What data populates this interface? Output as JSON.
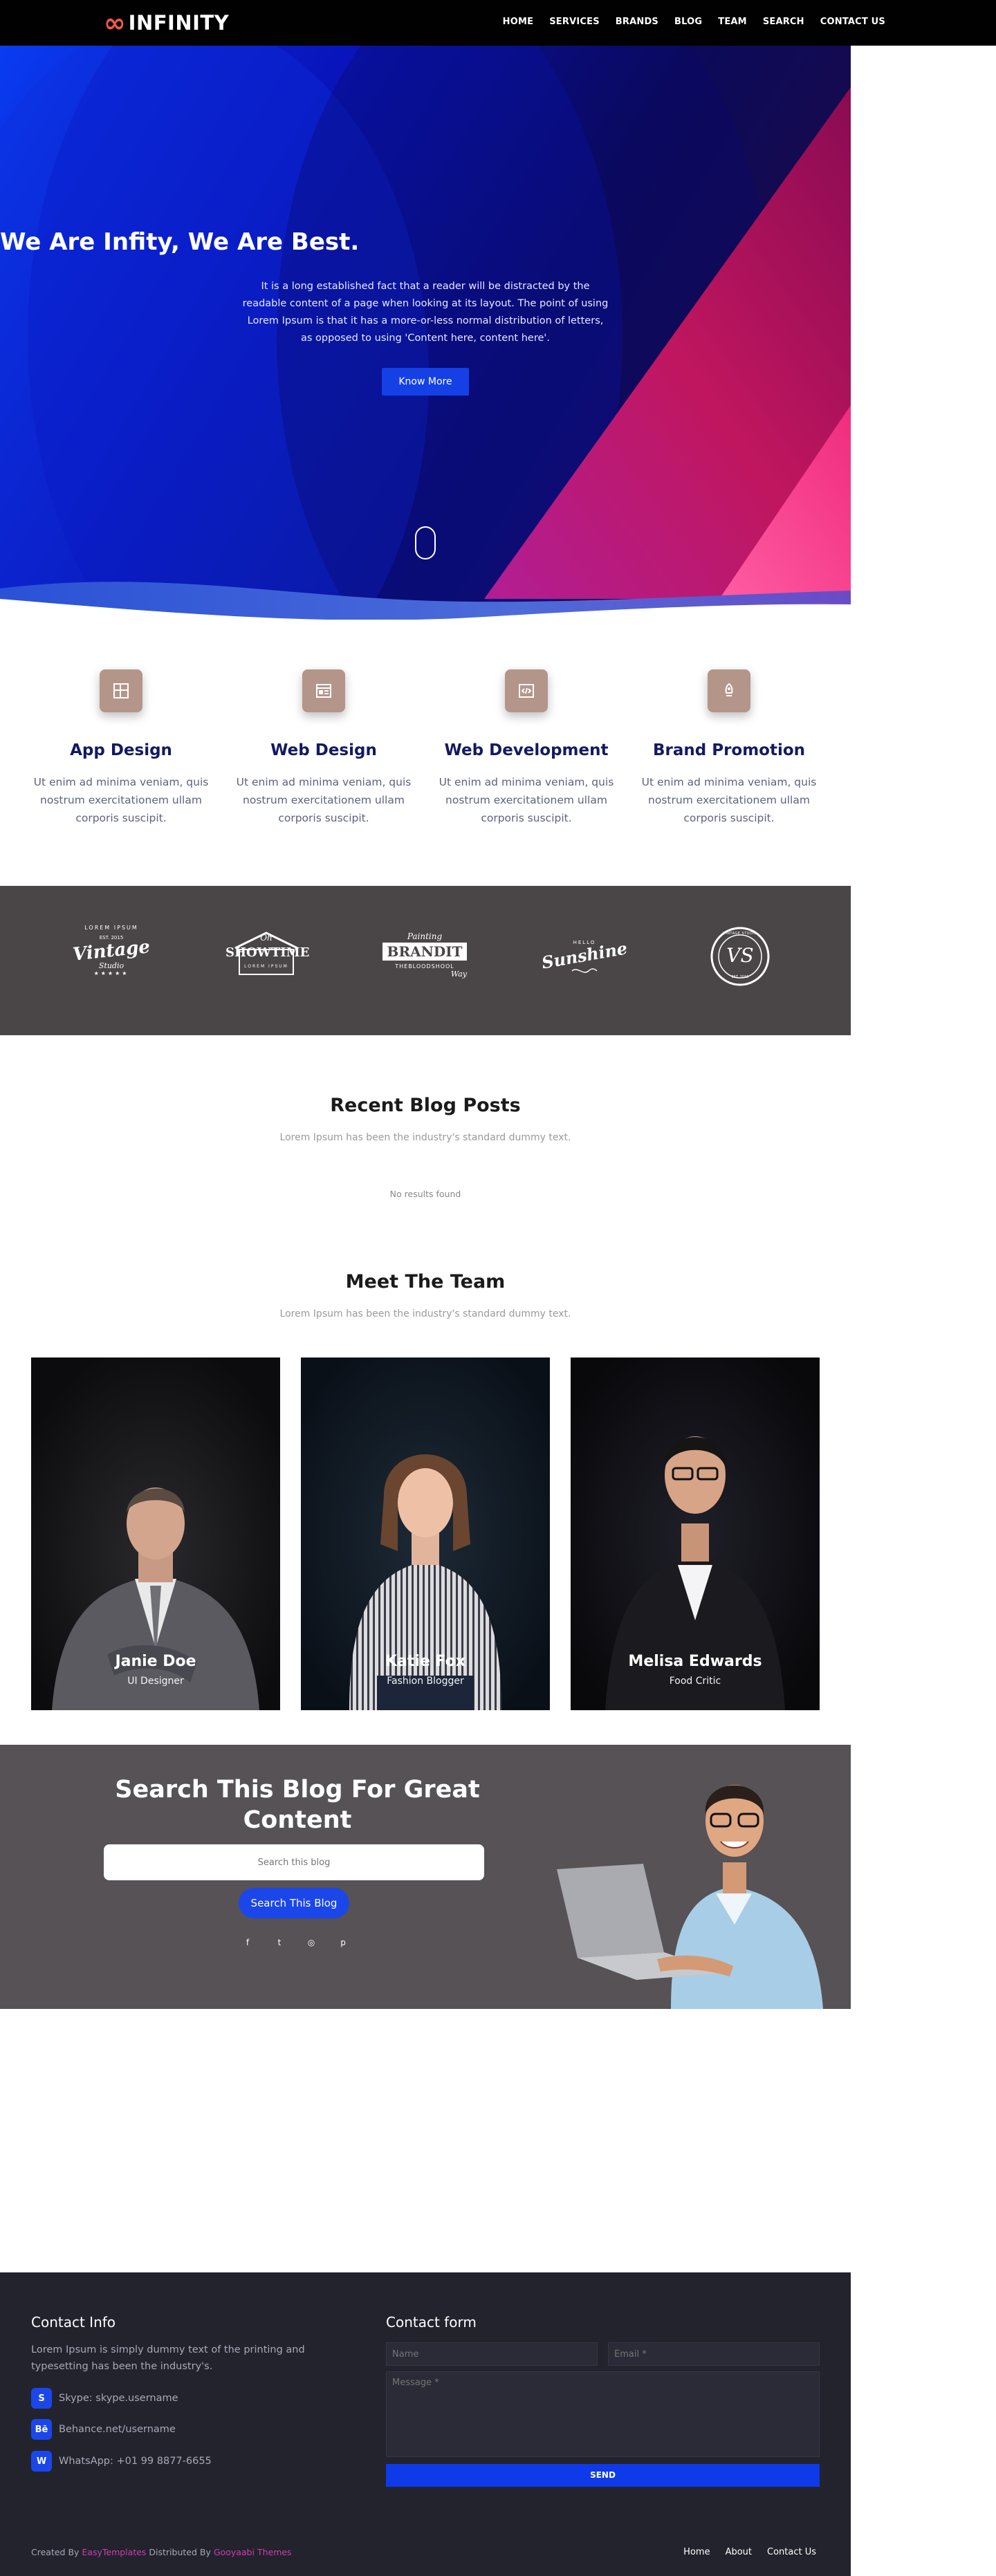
{
  "nav": {
    "logo_symbol": "∞",
    "logo_text": "INFINITY",
    "items": [
      "HOME",
      "SERVICES",
      "BRANDS",
      "BLOG",
      "TEAM",
      "SEARCH",
      "CONTACT US"
    ]
  },
  "hero": {
    "title": "We Are Infity, We Are Best.",
    "text": "It is a long established fact that a reader will be distracted by the readable content of a page when looking at its layout. The point of using Lorem Ipsum is that it has a more-or-less normal distribution of letters, as opposed to using 'Content here, content here'.",
    "button": "Know More"
  },
  "services": [
    {
      "icon": "layout-icon",
      "title": "App Design",
      "text": "Ut enim ad minima veniam, quis nostrum exercitationem ullam corporis suscipit."
    },
    {
      "icon": "browser-icon",
      "title": "Web Design",
      "text": "Ut enim ad minima veniam, quis nostrum exercitationem ullam corporis suscipit."
    },
    {
      "icon": "code-icon",
      "title": "Web Development",
      "text": "Ut enim ad minima veniam, quis nostrum exercitationem ullam corporis suscipit."
    },
    {
      "icon": "rocket-icon",
      "title": "Brand Promotion",
      "text": "Ut enim ad minima veniam, quis nostrum exercitationem ullam corporis suscipit."
    }
  ],
  "brands": {
    "vintage": {
      "top": "LOREM IPSUM",
      "sub": "EST. 2015",
      "main": "Vintage",
      "small": "Studio"
    },
    "showtime": {
      "top": "Oh",
      "main": "SHOWTIME",
      "small": "LOREM IPSUM"
    },
    "brandit": {
      "top": "Painting",
      "main": "BRANDIT",
      "sub": "THEBLOODSHOOL",
      "small": "Way"
    },
    "sunshine": {
      "top": "HELLO",
      "main": "Sunshine"
    },
    "vs": {
      "top": "VINTAGE STUDIO",
      "main": "VS",
      "small": "EST. 2015"
    }
  },
  "blog": {
    "title": "Recent Blog Posts",
    "subtitle": "Lorem Ipsum has been the industry's standard dummy text.",
    "empty": "No results found"
  },
  "team": {
    "title": "Meet The Team",
    "subtitle": "Lorem Ipsum has been the industry's standard dummy text.",
    "members": [
      {
        "name": "Janie Doe",
        "role": "UI Designer"
      },
      {
        "name": "Katie Fox",
        "role": "Fashion Blogger"
      },
      {
        "name": "Melisa Edwards",
        "role": "Food Critic"
      }
    ]
  },
  "search": {
    "title": "Search This Blog For Great Content",
    "placeholder": "Search this blog",
    "button": "Search This Blog",
    "socials": [
      "f",
      "t",
      "◎",
      "p"
    ]
  },
  "footer": {
    "info_title": "Contact Info",
    "info_text": "Lorem Ipsum is simply dummy text of the printing and typesetting has been the industry's.",
    "contacts": [
      {
        "icon": "S",
        "text": "Skype: skype.username"
      },
      {
        "icon": "Bē",
        "text": "Behance.net/username"
      },
      {
        "icon": "W",
        "text": "WhatsApp: +01 99 8877-6655"
      }
    ],
    "form_title": "Contact form",
    "name_placeholder": "Name",
    "email_placeholder": "Email *",
    "message_placeholder": "Message *",
    "send": "SEND",
    "credit_prefix": "Created By",
    "credit_author": "EasyTemplates",
    "credit_mid": "Distributed By",
    "credit_dist": "Gooyaabi Themes",
    "links": [
      "Home",
      "About",
      "Contact Us"
    ]
  }
}
